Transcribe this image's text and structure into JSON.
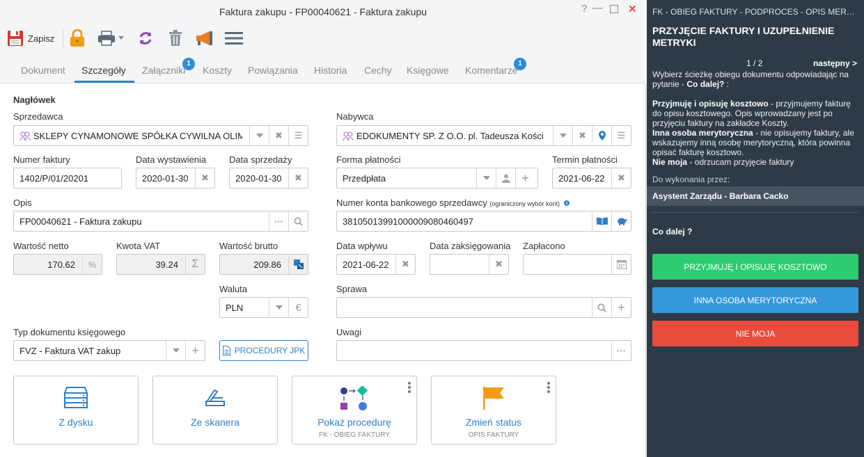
{
  "window": {
    "title": "Faktura zakupu - FP00040621 - Faktura zakupu",
    "help": "?",
    "minimize": "—",
    "close": "✕"
  },
  "toolbar": {
    "save_label": "Zapisz"
  },
  "tabs": [
    {
      "label": "Dokument"
    },
    {
      "label": "Szczegóły"
    },
    {
      "label": "Załączniki",
      "badge": "1"
    },
    {
      "label": "Koszty"
    },
    {
      "label": "Powiązania"
    },
    {
      "label": "Historia"
    },
    {
      "label": "Cechy"
    },
    {
      "label": "Księgowe"
    },
    {
      "label": "Komentarze",
      "badge": "1"
    }
  ],
  "form": {
    "section": "Nagłówek",
    "seller": {
      "label": "Sprzedawca",
      "value": "SKLEPY CYNAMONOWE SPÓŁKA CYWILNA OLIM..."
    },
    "buyer": {
      "label": "Nabywca",
      "value": "EDOKUMENTY SP. Z O.O. pl. Tadeusza Kości..."
    },
    "invoice_number": {
      "label": "Numer faktury",
      "value": "1402/P/01/20201"
    },
    "issue_date": {
      "label": "Data wystawienia",
      "value": "2020-01-30"
    },
    "sale_date": {
      "label": "Data sprzedaży",
      "value": "2020-01-30"
    },
    "payment_form": {
      "label": "Forma płatności",
      "value": "Przedpłata"
    },
    "payment_due": {
      "label": "Termin płatności",
      "value": "2021-06-22"
    },
    "description": {
      "label": "Opis",
      "value": "FP00040621 - Faktura zakupu"
    },
    "bank_account": {
      "label": "Numer konta bankowego sprzedawcy",
      "note": "(ograniczony wybór kont)",
      "value": "38105013991000009080460497"
    },
    "net": {
      "label": "Wartość netto",
      "value": "170.62"
    },
    "vat": {
      "label": "Kwota VAT",
      "value": "39.24"
    },
    "gross": {
      "label": "Wartość brutto",
      "value": "209.86"
    },
    "receipt_date": {
      "label": "Data wpływu",
      "value": "2021-06-22"
    },
    "booking_date": {
      "label": "Data zaksięgowania",
      "value": ""
    },
    "paid": {
      "label": "Zapłacono",
      "value": ""
    },
    "currency": {
      "label": "Waluta",
      "value": "PLN"
    },
    "case": {
      "label": "Sprawa",
      "value": ""
    },
    "doc_type": {
      "label": "Typ dokumentu księgowego",
      "value": "FVZ - Faktura VAT zakup"
    },
    "jpk_button": "PROCEDURY JPK",
    "remarks": {
      "label": "Uwagi",
      "value": ""
    }
  },
  "tiles": [
    {
      "label": "Z dysku",
      "sub": ""
    },
    {
      "label": "Ze skanera",
      "sub": ""
    },
    {
      "label": "Pokaż procedurę",
      "sub": "FK - OBIEG FAKTURY"
    },
    {
      "label": "Zmień status",
      "sub": "OPIS FAKTURY"
    }
  ],
  "panel": {
    "header": "FK - OBIEG FAKTURY - PODPROCES - OPIS MERYTORYCZNY",
    "title": "PRZYJĘCIE FAKTURY I UZUPEŁNIENIE METRYKI",
    "pager": "1 / 2",
    "next": "następny >",
    "intro": "Wybierz ścieżkę obiegu dokumentu odpowiadając na pytanie -",
    "intro_q": "Co dalej?",
    "intro_end": ":",
    "opt1_bold": "Przyjmuję i opisuję kosztowo",
    "opt1_text": "- przyjmujemy fakturę do opisu kosztowego. Opis wprowadzany jest po przyjęciu faktury na zakładce Koszty.",
    "opt2_bold": "Inna osoba merytoryczna",
    "opt2_text": "- nie opisujemy faktury, ale wskazujemy inną osobę merytoryczną, która powinna opisać fakturę kosztowo.",
    "opt3_bold": "Nie moja",
    "opt3_text": "- odrzucam przyjęcie faktury",
    "assignee_label": "Do wykonania przez:",
    "assignee": "Asystent Zarządu - Barbara Cacko",
    "question": "Co dalej ?",
    "buttons": [
      {
        "label": "PRZYJMUJĘ I OPISUJĘ KOSZTOWO",
        "color": "#2ecc71"
      },
      {
        "label": "INNA OSOBA MERYTORYCZNA",
        "color": "#3498db"
      },
      {
        "label": "NIE MOJA",
        "color": "#e74c3c"
      }
    ]
  }
}
